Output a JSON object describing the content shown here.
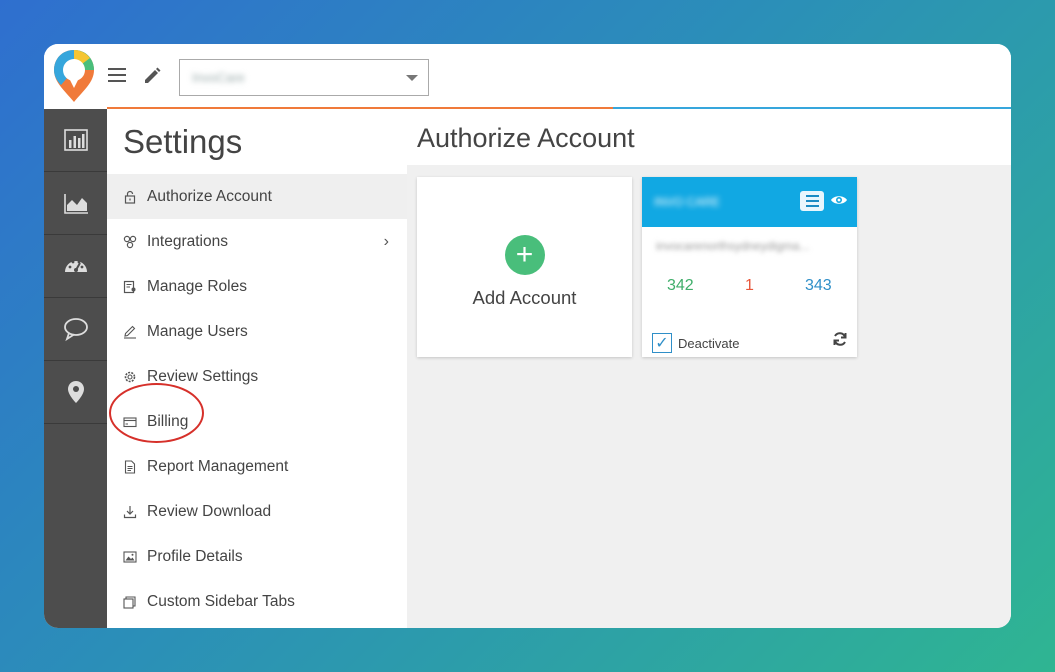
{
  "topbar": {
    "location_value": "InvoCare"
  },
  "rail": {
    "items": [
      {
        "icon": "bar-chart-icon"
      },
      {
        "icon": "area-chart-icon"
      },
      {
        "icon": "dashboard-gauge-icon"
      },
      {
        "icon": "chat-bubble-icon"
      },
      {
        "icon": "map-pin-icon"
      }
    ]
  },
  "settings": {
    "title": "Settings",
    "items": [
      {
        "label": "Authorize Account",
        "icon": "lock-icon",
        "active": true
      },
      {
        "label": "Integrations",
        "icon": "integrations-icon",
        "has_arrow": true,
        "arrow": "›"
      },
      {
        "label": "Manage Roles",
        "icon": "roles-icon"
      },
      {
        "label": "Manage Users",
        "icon": "pencil-icon"
      },
      {
        "label": "Review Settings",
        "icon": "gear-icon"
      },
      {
        "label": "Billing",
        "icon": "credit-card-icon"
      },
      {
        "label": "Report Management",
        "icon": "document-icon"
      },
      {
        "label": "Review Download",
        "icon": "download-icon"
      },
      {
        "label": "Profile Details",
        "icon": "image-icon"
      },
      {
        "label": "Custom Sidebar Tabs",
        "icon": "tabs-icon"
      }
    ]
  },
  "main": {
    "title": "Authorize Account",
    "add_card": {
      "plus": "+",
      "label": "Add Account"
    },
    "account_card": {
      "name": "INVO CARE",
      "url": "invocarenorthsydneydigma...",
      "stats": [
        "342",
        "1",
        "343"
      ],
      "checkbox_mark": "✓",
      "deactivate_label": "Deactivate"
    }
  },
  "colors": {
    "accent_orange": "#f07a3a",
    "accent_blue": "#36a6dc",
    "card_header": "#11a8e3",
    "add_green": "#49be7b",
    "stat_green": "#3fae6a",
    "stat_red": "#e8563a",
    "stat_blue": "#2f8fc8",
    "rail_bg": "#4d4d4d"
  }
}
